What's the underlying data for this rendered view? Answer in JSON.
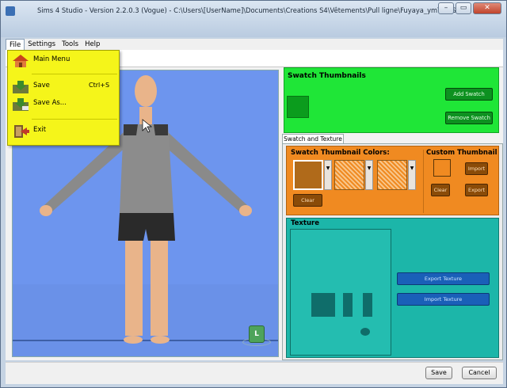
{
  "window": {
    "title": "Sims 4 Studio - Version 2.2.0.3  (Vogue)   - C:\\Users\\[UserName]\\Documents\\Creations S4\\Vêtements\\Pull ligne\\Fuyaya_ymTop_Sweater_Ligne.package",
    "minimize": "–",
    "maximize": "▭",
    "close": "✕"
  },
  "menubar": {
    "items": [
      "File",
      "Settings",
      "Tools",
      "Help"
    ]
  },
  "file_menu": {
    "items": [
      {
        "label": "Main Menu",
        "shortcut": "",
        "icon": "home-icon"
      },
      {
        "label": "Save",
        "shortcut": "Ctrl+S",
        "icon": "save-icon"
      },
      {
        "label": "Save As...",
        "shortcut": "",
        "icon": "save-as-icon"
      },
      {
        "label": "Exit",
        "shortcut": "",
        "icon": "exit-icon"
      }
    ]
  },
  "viewport": {
    "char_icon": "L"
  },
  "swatch_panel": {
    "title": "Swatch Thumbnails",
    "add_button": "Add Swatch",
    "remove_button": "Remove Swatch",
    "swatch_color": "#0b9c1d"
  },
  "tab": {
    "label": "Swatch and Texture"
  },
  "thumb_colors": {
    "title": "Swatch Thumbnail Colors:",
    "clear_button": "Clear"
  },
  "custom_thumb": {
    "title": "Custom Thumbnail",
    "import_button": "Import",
    "clear_button": "Clear",
    "export_button": "Export"
  },
  "texture_panel": {
    "title": "Texture",
    "export_button": "Export Texture",
    "import_button": "Import Texture"
  },
  "footer": {
    "save_button": "Save",
    "cancel_button": "Cancel"
  },
  "colors": {
    "menu_bg": "#f5f51a",
    "swatch_bg": "#1fe637",
    "orange_bg": "#f08a21",
    "teal_bg": "#1cb6a9",
    "viewport_bg": "#6d95ee"
  }
}
